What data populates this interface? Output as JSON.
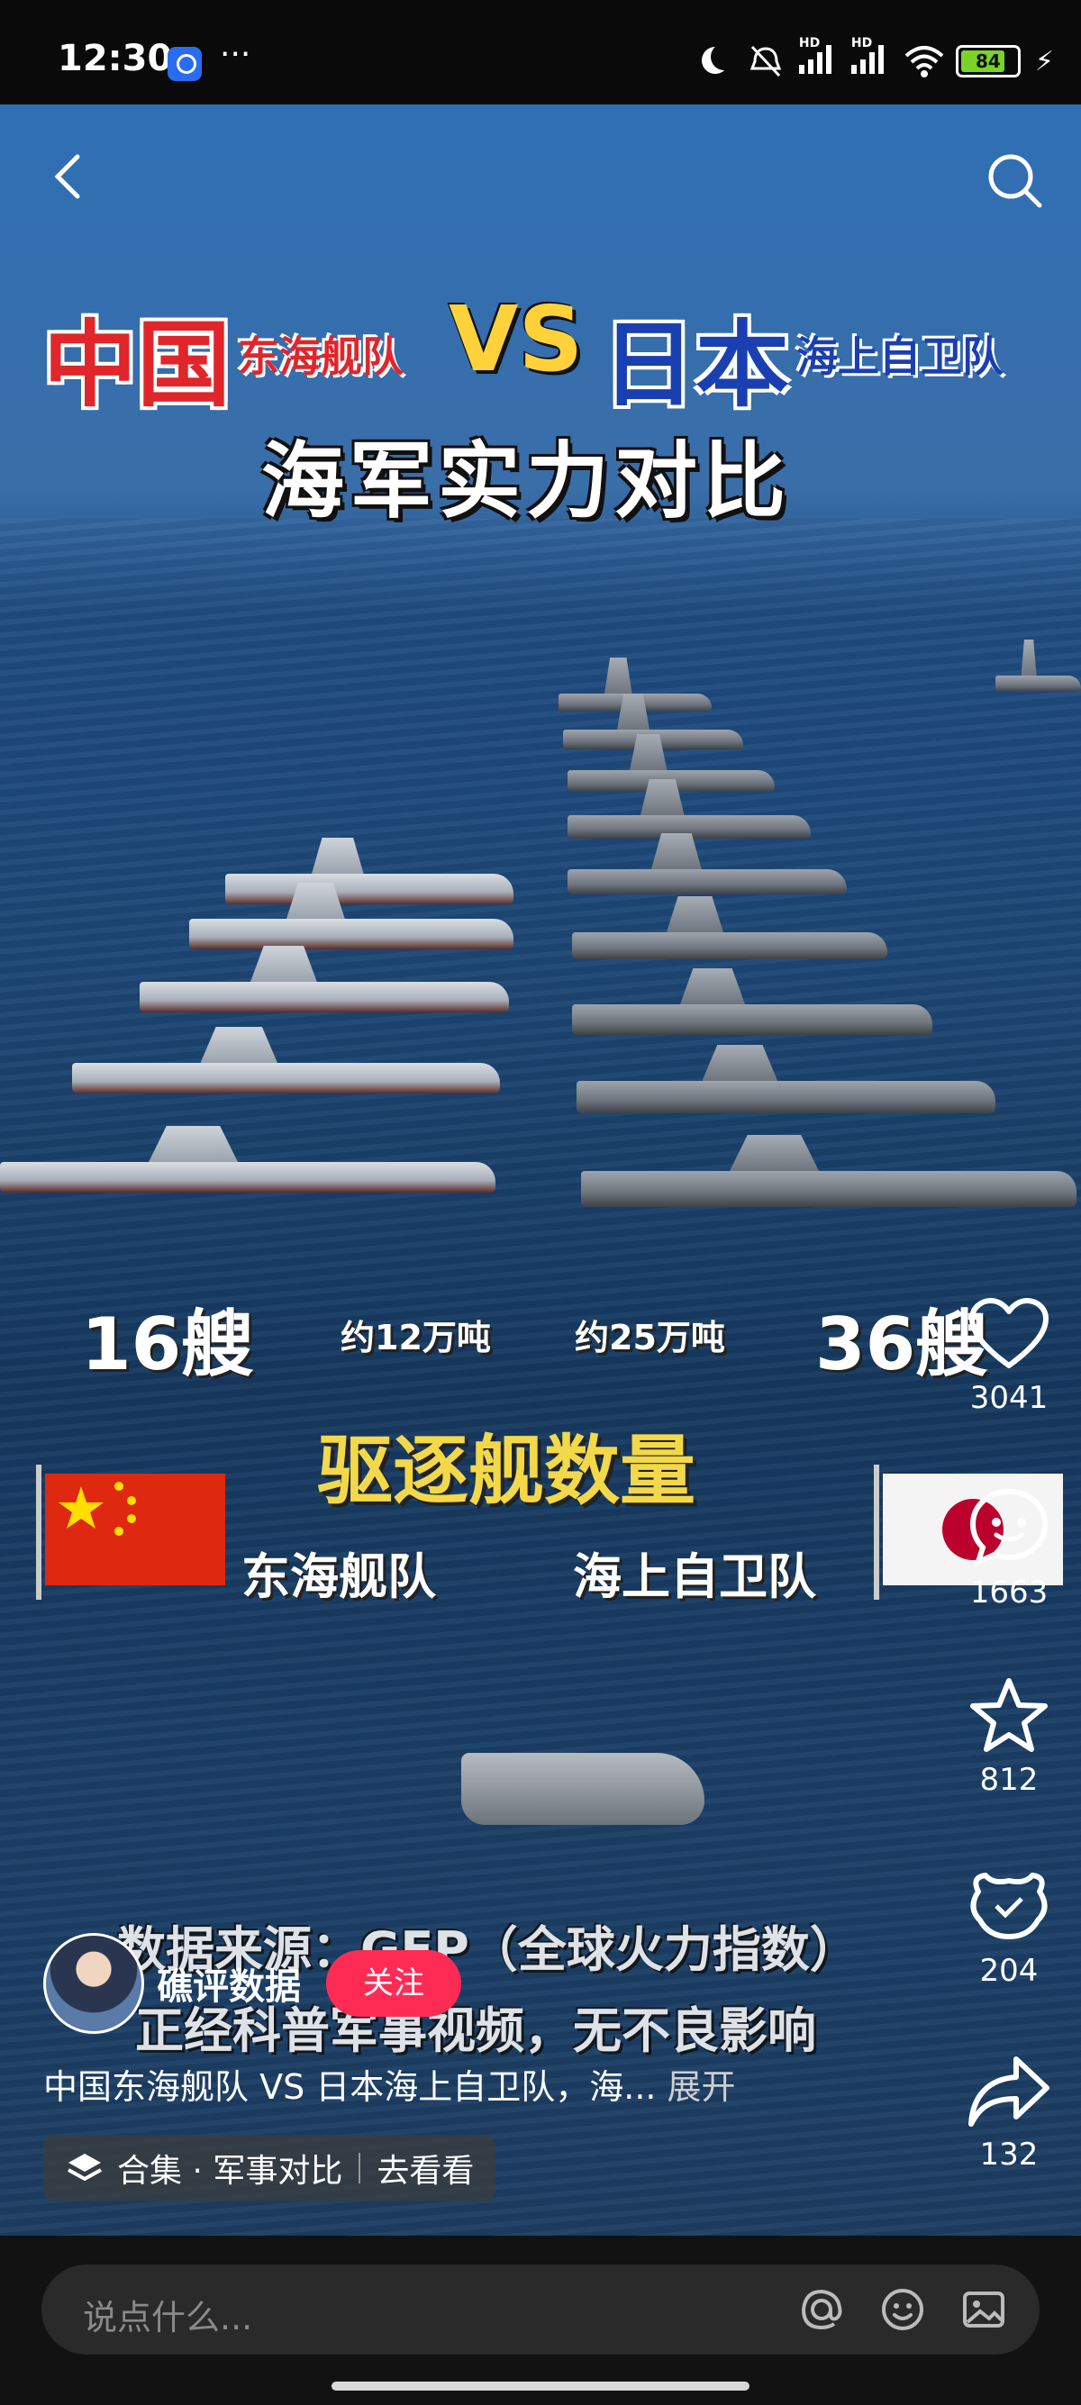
{
  "status_bar": {
    "time": "12:30",
    "more": "···",
    "battery": "84"
  },
  "video": {
    "title_left": "中国",
    "title_left_sub": "东海舰队",
    "vs": "VS",
    "title_right": "日本",
    "title_right_sub": "海上自卫队",
    "subtitle": "海军实力对比",
    "left_count": "16艘",
    "left_tonnage": "约12万吨",
    "right_tonnage": "约25万吨",
    "right_count": "36艘",
    "metric": "驱逐舰数量",
    "left_team": "东海舰队",
    "right_team": "海上自卫队",
    "source_line1": "数据来源：GFP（全球火力指数）",
    "source_line2": "正经科普军事视频，无不良影响"
  },
  "actions": {
    "like": {
      "icon": "heart-icon",
      "count": "3041"
    },
    "comment": {
      "icon": "comment-icon",
      "count": "1663"
    },
    "favorite": {
      "icon": "star-icon",
      "count": "812"
    },
    "gift": {
      "icon": "gift-icon",
      "count": "204"
    },
    "share": {
      "icon": "share-icon",
      "count": "132"
    }
  },
  "author": {
    "name": "礁评数据",
    "follow_label": "关注"
  },
  "description": {
    "text": "中国东海舰队 VS 日本海上自卫队，海...",
    "expand_label": "展开"
  },
  "collection": {
    "label": "合集 · 军事对比",
    "action": "去看看"
  },
  "comment_input": {
    "placeholder": "说点什么..."
  },
  "colors": {
    "accent": "#fe2c55",
    "background": "#000000"
  }
}
